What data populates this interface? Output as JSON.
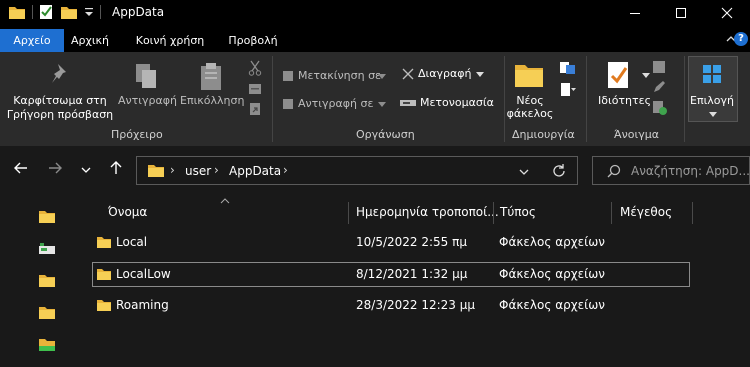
{
  "window": {
    "title": "AppData"
  },
  "tabs": [
    {
      "label": "Αρχείο",
      "active": true
    },
    {
      "label": "Αρχική"
    },
    {
      "label": "Κοινή χρήση"
    },
    {
      "label": "Προβολή"
    }
  ],
  "ribbon": {
    "clipboard": {
      "pin_line1": "Καρφίτσωμα στη",
      "pin_line2": "Γρήγορη πρόσβαση",
      "copy": "Αντιγραφή",
      "paste": "Επικόλληση",
      "group": "Πρόχειρο"
    },
    "organize": {
      "move_to": "Μετακίνηση σε",
      "copy_to": "Αντιγραφή σε",
      "delete": "Διαγραφή",
      "rename": "Μετονομασία",
      "group": "Οργάνωση"
    },
    "new": {
      "folder_line1": "Νέος",
      "folder_line2": "φάκελος",
      "group": "Δημιουργία"
    },
    "open": {
      "properties": "Ιδιότητες",
      "group": "Άνοιγμα"
    },
    "select": {
      "label": "Επιλογή"
    }
  },
  "address": {
    "crumbs": [
      "user",
      "AppData"
    ],
    "search_placeholder": "Αναζήτηση: AppD..."
  },
  "columns": [
    "Όνομα",
    "Ημερομηνία τροποποί...",
    "Τύπος",
    "Μέγεθος"
  ],
  "rows": [
    {
      "name": "Local",
      "date": "10/5/2022 2:55 πμ",
      "type": "Φάκελος αρχείων"
    },
    {
      "name": "LocalLow",
      "date": "8/12/2021 1:32 μμ",
      "type": "Φάκελος αρχείων",
      "selected": true
    },
    {
      "name": "Roaming",
      "date": "28/3/2022 12:23 μμ",
      "type": "Φάκελος αρχείων"
    }
  ],
  "colors": {
    "accent": "#1e6fd1",
    "folder": "#f2c041",
    "background": "#191919",
    "ribbon": "#2b2b2b"
  }
}
